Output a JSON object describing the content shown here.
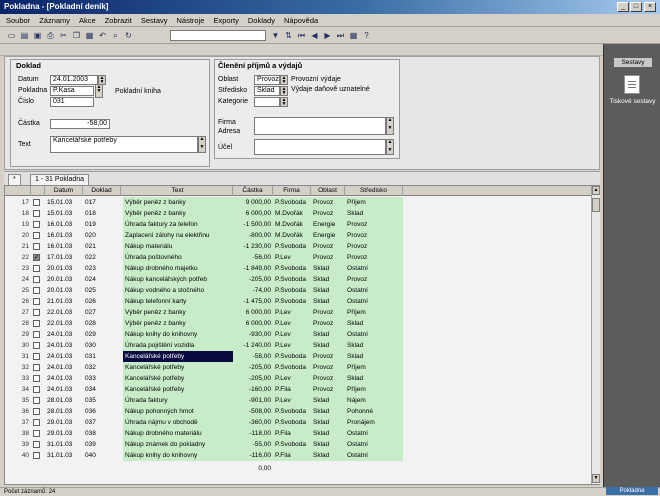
{
  "window": {
    "title": "Pokladna - [Pokladní deník]",
    "minimize": "_",
    "maximize": "□",
    "close": "×"
  },
  "menu": [
    "Soubor",
    "Záznamy",
    "Akce",
    "Zobrazit",
    "Sestavy",
    "Nástroje",
    "Exporty",
    "Doklady",
    "Nápověda"
  ],
  "toolbar": {
    "icons_left": [
      {
        "name": "new-icon",
        "glyph": "▭"
      },
      {
        "name": "open-icon",
        "glyph": "▤"
      },
      {
        "name": "save-icon",
        "glyph": "▣"
      },
      {
        "name": "print-icon",
        "glyph": "⎙"
      },
      {
        "name": "cut-icon",
        "glyph": "✂"
      },
      {
        "name": "copy-icon",
        "glyph": "❐"
      },
      {
        "name": "paste-icon",
        "glyph": "▦"
      },
      {
        "name": "undo-icon",
        "glyph": "↶"
      },
      {
        "name": "find-icon",
        "glyph": "⌕"
      },
      {
        "name": "refresh-icon",
        "glyph": "↻"
      }
    ],
    "search_value": "",
    "icons_right": [
      {
        "name": "filter-icon",
        "glyph": "▼"
      },
      {
        "name": "sort-icon",
        "glyph": "⇅"
      },
      {
        "name": "first-record-icon",
        "glyph": "⏮"
      },
      {
        "name": "prev-record-icon",
        "glyph": "◀"
      },
      {
        "name": "next-record-icon",
        "glyph": "▶"
      },
      {
        "name": "last-record-icon",
        "glyph": "⏭"
      },
      {
        "name": "calculator-icon",
        "glyph": "▦"
      },
      {
        "name": "help-icon",
        "glyph": "?"
      }
    ]
  },
  "doklad": {
    "heading": "Doklad",
    "date_label": "Datum",
    "date_value": "24.01.2003",
    "cash_label": "Pokladna",
    "cash_value": "P.Kasa",
    "number_label": "Číslo",
    "number_value": "031",
    "book_label": "Pokladní kniha",
    "amount_label": "Částka",
    "amount_value": "-58,00",
    "text_label": "Text",
    "text_value": "Kancelářské potřeby"
  },
  "cleneni": {
    "heading": "Členění příjmů a výdajů",
    "area_label": "Oblast",
    "area_value": "Provoz",
    "center_label": "Středisko",
    "center_value": "Sklad",
    "category_label": "Kategorie",
    "category_value": "",
    "type1": "Provozní výdaje",
    "type2": "Výdaje daňově uznatelné",
    "firm_label": "Firma",
    "firm_value": "",
    "address_label": "Adresa",
    "address_value": "",
    "purpose_label": "Účel",
    "purpose_value": ""
  },
  "tabs": {
    "new": "*",
    "active": "1 - 31 Pokladna"
  },
  "table": {
    "columns": [
      "",
      "",
      "Datum",
      "Doklad",
      "Text",
      "Částka",
      "Firma",
      "Oblast",
      "Středisko"
    ],
    "rows": [
      {
        "n": "17",
        "checked": false,
        "date": "15.01.03",
        "doc": "017",
        "text": "Výběr peněz z banky",
        "amount": "9 000,00",
        "firm": "P.Svoboda",
        "area": "Provoz",
        "center": "Příjem"
      },
      {
        "n": "18",
        "checked": false,
        "date": "15.01.03",
        "doc": "018",
        "text": "Výběr peněz z banky",
        "amount": "6 000,00",
        "firm": "M.Dvořák",
        "area": "Provoz",
        "center": "Sklad"
      },
      {
        "n": "19",
        "checked": false,
        "date": "16.01.03",
        "doc": "019",
        "text": "Úhrada faktury za telefon",
        "amount": "-1 500,00",
        "firm": "M.Dvořák",
        "area": "Energie",
        "center": "Provoz"
      },
      {
        "n": "20",
        "checked": false,
        "date": "16.01.03",
        "doc": "020",
        "text": "Zaplacení zálohy na elektřinu",
        "amount": "-800,00",
        "firm": "M.Dvořák",
        "area": "Energie",
        "center": "Provoz"
      },
      {
        "n": "21",
        "checked": false,
        "date": "16.01.03",
        "doc": "021",
        "text": "Nákup materiálu",
        "amount": "-1 230,00",
        "firm": "P.Svoboda",
        "area": "Provoz",
        "center": "Provoz"
      },
      {
        "n": "22",
        "checked": true,
        "date": "17.01.03",
        "doc": "022",
        "text": "Úhrada poštovného",
        "amount": "-56,00",
        "firm": "P.Lev",
        "area": "Provoz",
        "center": "Provoz"
      },
      {
        "n": "23",
        "checked": false,
        "date": "20.01.03",
        "doc": "023",
        "text": "Nákup drobného majetku",
        "amount": "-1 849,00",
        "firm": "P.Svoboda",
        "area": "Sklad",
        "center": "Ostatní"
      },
      {
        "n": "24",
        "checked": false,
        "date": "20.01.03",
        "doc": "024",
        "text": "Nákup kancelářských potřeb",
        "amount": "-205,00",
        "firm": "P.Svoboda",
        "area": "Sklad",
        "center": "Provoz"
      },
      {
        "n": "25",
        "checked": false,
        "date": "20.01.03",
        "doc": "025",
        "text": "Nákup vodného a stočného",
        "amount": "-74,00",
        "firm": "P.Svoboda",
        "area": "Sklad",
        "center": "Ostatní"
      },
      {
        "n": "26",
        "checked": false,
        "date": "21.01.03",
        "doc": "026",
        "text": "Nákup telefonní karty",
        "amount": "-1 475,00",
        "firm": "P.Svoboda",
        "area": "Sklad",
        "center": "Ostatní"
      },
      {
        "n": "27",
        "checked": false,
        "date": "22.01.03",
        "doc": "027",
        "text": "Výběr peněz z banky",
        "amount": "6 000,00",
        "firm": "P.Lev",
        "area": "Provoz",
        "center": "Příjem"
      },
      {
        "n": "28",
        "checked": false,
        "date": "22.01.03",
        "doc": "028",
        "text": "Výběr peněz z banky",
        "amount": "6 000,00",
        "firm": "P.Lev",
        "area": "Provoz",
        "center": "Sklad"
      },
      {
        "n": "29",
        "checked": false,
        "date": "24.01.03",
        "doc": "029",
        "text": "Nákup knihy do knihovny",
        "amount": "-930,00",
        "firm": "P.Lev",
        "area": "Sklad",
        "center": "Ostatní"
      },
      {
        "n": "30",
        "checked": false,
        "date": "24.01.03",
        "doc": "030",
        "text": "Úhrada pojištění vozidla",
        "amount": "-1 240,00",
        "firm": "P.Lev",
        "area": "Sklad",
        "center": "Sklad"
      },
      {
        "n": "31",
        "checked": false,
        "date": "24.01.03",
        "doc": "031",
        "text": "Kancelářské potřeby",
        "amount": "-58,00",
        "firm": "P.Svoboda",
        "area": "Provoz",
        "center": "Sklad",
        "selected": true
      },
      {
        "n": "32",
        "checked": false,
        "date": "24.01.03",
        "doc": "032",
        "text": "Kancelářské potřeby",
        "amount": "-205,00",
        "firm": "P.Svoboda",
        "area": "Provoz",
        "center": "Příjem"
      },
      {
        "n": "33",
        "checked": false,
        "date": "24.01.03",
        "doc": "033",
        "text": "Kancelářské potřeby",
        "amount": "-205,00",
        "firm": "P.Lev",
        "area": "Provoz",
        "center": "Sklad"
      },
      {
        "n": "34",
        "checked": false,
        "date": "24.01.03",
        "doc": "034",
        "text": "Kancelářské potřeby",
        "amount": "-160,00",
        "firm": "P.Fila",
        "area": "Provoz",
        "center": "Příjem"
      },
      {
        "n": "35",
        "checked": false,
        "date": "28.01.03",
        "doc": "035",
        "text": "Úhrada faktury",
        "amount": "-901,00",
        "firm": "P.Lev",
        "area": "Sklad",
        "center": "Nájem"
      },
      {
        "n": "36",
        "checked": false,
        "date": "28.01.03",
        "doc": "036",
        "text": "Nákup pohonných hmot",
        "amount": "-508,00",
        "firm": "P.Svoboda",
        "area": "Sklad",
        "center": "Pohonné"
      },
      {
        "n": "37",
        "checked": false,
        "date": "29.01.03",
        "doc": "037",
        "text": "Úhrada nájmu v obchodě",
        "amount": "-360,00",
        "firm": "P.Svoboda",
        "area": "Sklad",
        "center": "Pronájem"
      },
      {
        "n": "38",
        "checked": false,
        "date": "29.01.03",
        "doc": "038",
        "text": "Nákup drobného materiálu",
        "amount": "-118,00",
        "firm": "P.Fila",
        "area": "Sklad",
        "center": "Ostatní"
      },
      {
        "n": "39",
        "checked": false,
        "date": "31.01.03",
        "doc": "039",
        "text": "Nákup známek do pokladny",
        "amount": "-55,00",
        "firm": "P.Svoboda",
        "area": "Sklad",
        "center": "Ostatní"
      },
      {
        "n": "40",
        "checked": false,
        "date": "31.01.03",
        "doc": "040",
        "text": "Nákup knihy do knihovny",
        "amount": "-116,00",
        "firm": "P.Fila",
        "area": "Sklad",
        "center": "Ostatní"
      }
    ],
    "total": "0,00"
  },
  "right_panel": {
    "heading": "Sestavy",
    "item_label": "Tiskové sestavy",
    "item_icon": "document-icon"
  },
  "status": {
    "left": "Počet záznamů: 24",
    "right": "Pokladna"
  },
  "colors": {
    "titlebar": "#0a246a",
    "row_highlight": "#c8ecc8",
    "selection": "#0a0a40",
    "panel": "#5c5c5c"
  }
}
